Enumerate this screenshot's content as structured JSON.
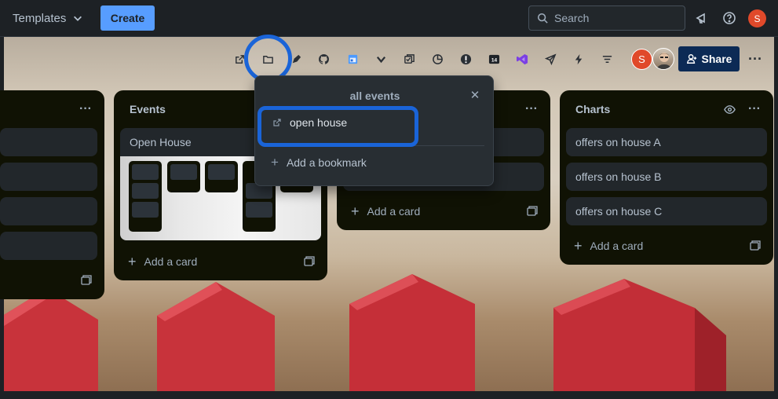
{
  "topbar": {
    "templates_label": "Templates",
    "create_label": "Create",
    "search_placeholder": "Search",
    "avatar_initial": "S",
    "icons": [
      "chevron-down-icon",
      "search-icon",
      "megaphone-icon",
      "help-icon"
    ]
  },
  "board_header": {
    "icons": [
      "external-link-icon",
      "folder-icon",
      "pen-icon",
      "github-icon",
      "calendar-icon",
      "chevron-down-icon",
      "copy-icon",
      "pie-chart-icon",
      "alert-icon",
      "calendar-14-icon",
      "visual-studio-icon",
      "send-icon",
      "lightning-icon",
      "filter-icon"
    ],
    "calendar_day": "14",
    "member_initial": "S",
    "share_label": "Share",
    "more_label": "···"
  },
  "lists": {
    "left_partial": {
      "card_count": 4
    },
    "events": {
      "title": "Events",
      "cover_card_title": "Open House",
      "add_card_label": "Add a card"
    },
    "middle_partial": {
      "add_card_label": "Add a card"
    },
    "charts": {
      "title": "Charts",
      "cards": [
        "offers on house A",
        "offers on house B",
        "offers on house C"
      ],
      "add_card_label": "Add a card"
    }
  },
  "popover": {
    "title": "all events",
    "items": [
      "open house"
    ],
    "add_bookmark_label": "Add a bookmark"
  },
  "colors": {
    "accent": "#579dff",
    "highlight_ring": "#1a64d8",
    "list_bg": "#101204",
    "card_bg": "#22272b",
    "share_bg": "#0c2a55",
    "avatar": "#e0492a"
  }
}
